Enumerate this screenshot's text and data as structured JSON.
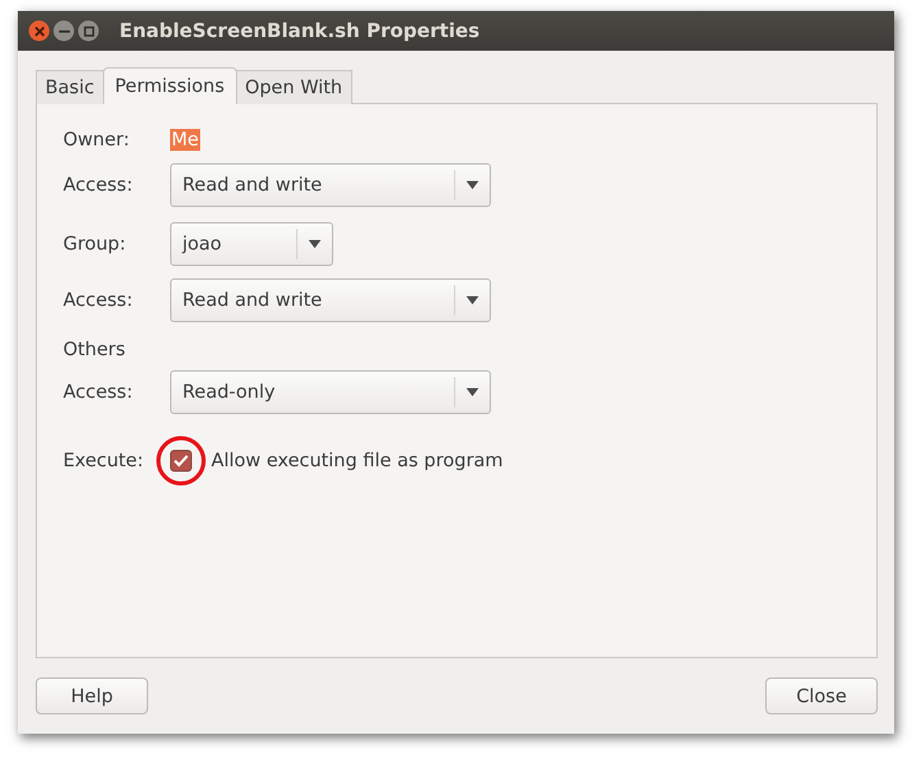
{
  "window": {
    "title": "EnableScreenBlank.sh Properties"
  },
  "tabs": [
    {
      "label": "Basic",
      "selected": false
    },
    {
      "label": "Permissions",
      "selected": true
    },
    {
      "label": "Open With",
      "selected": false
    }
  ],
  "rows": [
    {
      "kind": "text",
      "label": "Owner:",
      "value": "Me",
      "highlighted": true
    },
    {
      "kind": "combo",
      "label": "Access:",
      "value": "Read and write",
      "wide": true
    },
    {
      "kind": "combo",
      "label": "Group:",
      "value": "joao",
      "wide": false
    },
    {
      "kind": "combo",
      "label": "Access:",
      "value": "Read and write",
      "wide": true
    },
    {
      "kind": "heading",
      "label": "Others"
    },
    {
      "kind": "combo",
      "label": "Access:",
      "value": "Read-only",
      "wide": true
    },
    {
      "kind": "check",
      "label": "Execute:",
      "value": "Allow executing file as program",
      "checked": true,
      "circled": true
    }
  ],
  "buttons": [
    "Help",
    "Close"
  ]
}
